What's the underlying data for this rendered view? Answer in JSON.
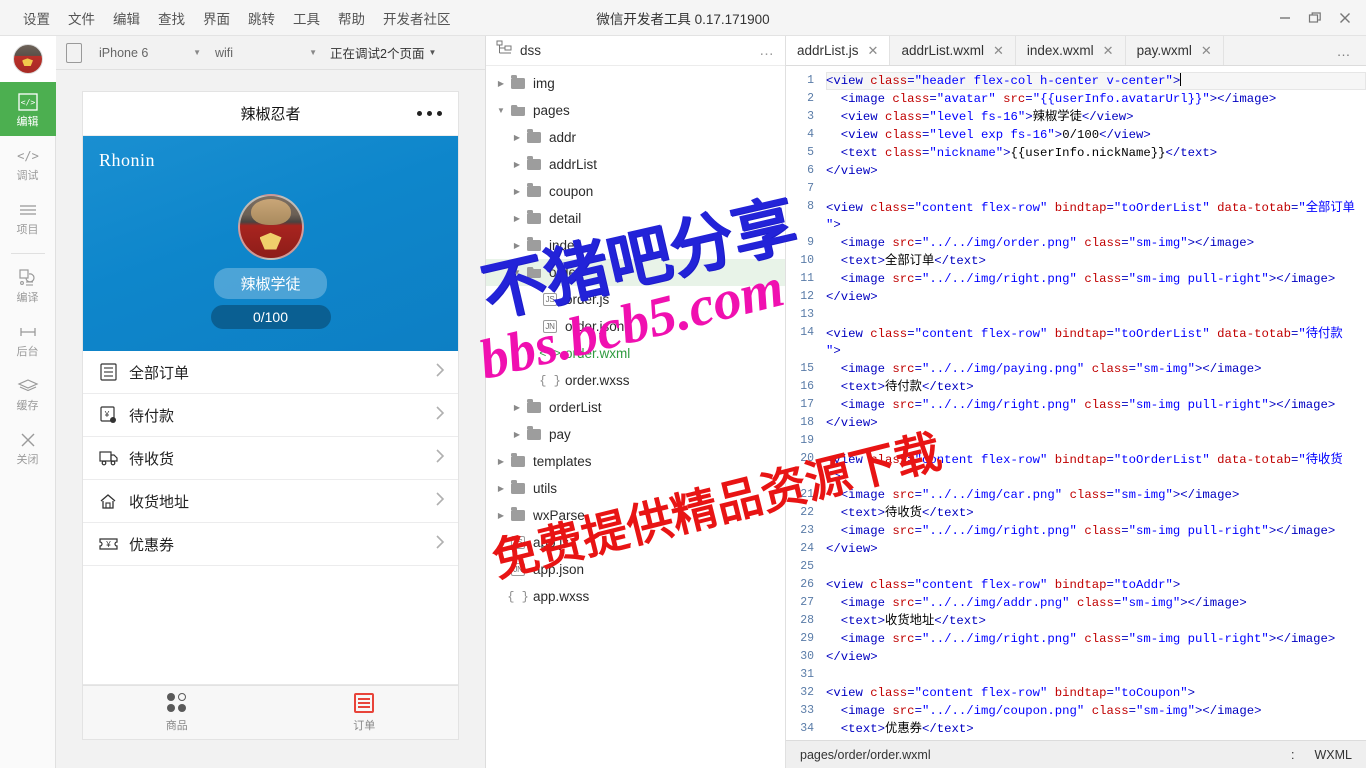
{
  "window": {
    "title": "微信开发者工具 0.17.171900",
    "menu": [
      "设置",
      "文件",
      "编辑",
      "查找",
      "界面",
      "跳转",
      "工具",
      "帮助",
      "开发者社区"
    ],
    "controls": [
      "minimize-button",
      "restore-button",
      "close-button"
    ]
  },
  "rail": {
    "avatar": "user-avatar",
    "items": [
      {
        "label": "编辑",
        "icon": "code-box-icon",
        "active": true
      },
      {
        "label": "调试",
        "icon": "code-icon",
        "active": false
      },
      {
        "label": "项目",
        "icon": "lines-icon",
        "active": false
      },
      {
        "label": "编译",
        "icon": "compile-icon",
        "active": false
      },
      {
        "label": "后台",
        "icon": "background-icon",
        "active": false
      },
      {
        "label": "缓存",
        "icon": "layers-icon",
        "active": false
      },
      {
        "label": "关闭",
        "icon": "close-icon",
        "active": false
      }
    ]
  },
  "simulator": {
    "toolbar": {
      "rotate": "rotate-device-button",
      "device": "iPhone 6",
      "network": "wifi",
      "debug_status": "正在调试2个页面"
    },
    "phone": {
      "nav_title": "辣椒忍者",
      "menu_dots": "more-dots-icon",
      "nickname": "Rhonin",
      "level_badge": "辣椒学徒",
      "exp": "0/100",
      "rows": [
        {
          "label": "全部订单",
          "icon": "order-list-icon"
        },
        {
          "label": "待付款",
          "icon": "pay-pending-icon"
        },
        {
          "label": "待收货",
          "icon": "delivery-truck-icon"
        },
        {
          "label": "收货地址",
          "icon": "home-address-icon"
        },
        {
          "label": "优惠券",
          "icon": "coupon-icon"
        }
      ],
      "tabs": [
        {
          "label": "商品",
          "icon": "grid-dots-icon",
          "active": false
        },
        {
          "label": "订单",
          "icon": "order-list-icon",
          "active": true
        }
      ]
    }
  },
  "tree": {
    "project_name": "dss",
    "more": "…",
    "nodes": [
      {
        "label": "img",
        "type": "folder",
        "depth": 0,
        "open": false,
        "sel": false
      },
      {
        "label": "pages",
        "type": "folder",
        "depth": 0,
        "open": true,
        "sel": false
      },
      {
        "label": "addr",
        "type": "folder",
        "depth": 1,
        "open": false,
        "sel": false
      },
      {
        "label": "addrList",
        "type": "folder",
        "depth": 1,
        "open": false,
        "sel": false
      },
      {
        "label": "coupon",
        "type": "folder",
        "depth": 1,
        "open": false,
        "sel": false
      },
      {
        "label": "detail",
        "type": "folder",
        "depth": 1,
        "open": false,
        "sel": false
      },
      {
        "label": "index",
        "type": "folder",
        "depth": 1,
        "open": false,
        "sel": false
      },
      {
        "label": "order",
        "type": "folder",
        "depth": 1,
        "open": true,
        "sel": true
      },
      {
        "label": "order.js",
        "type": "js",
        "depth": 2,
        "sel": false
      },
      {
        "label": "order.json",
        "type": "json",
        "depth": 2,
        "sel": false
      },
      {
        "label": "order.wxml",
        "type": "wxml",
        "depth": 2,
        "sel": false,
        "green": true
      },
      {
        "label": "order.wxss",
        "type": "wxss",
        "depth": 2,
        "sel": false
      },
      {
        "label": "orderList",
        "type": "folder",
        "depth": 1,
        "open": false,
        "sel": false
      },
      {
        "label": "pay",
        "type": "folder",
        "depth": 1,
        "open": false,
        "sel": false
      },
      {
        "label": "templates",
        "type": "folder",
        "depth": 0,
        "open": false,
        "sel": false
      },
      {
        "label": "utils",
        "type": "folder",
        "depth": 0,
        "open": false,
        "sel": false
      },
      {
        "label": "wxParse",
        "type": "folder",
        "depth": 0,
        "open": false,
        "sel": false
      },
      {
        "label": "app.js",
        "type": "js",
        "depth": 0,
        "sel": false
      },
      {
        "label": "app.json",
        "type": "json",
        "depth": 0,
        "sel": false
      },
      {
        "label": "app.wxss",
        "type": "wxss",
        "depth": 0,
        "sel": false
      }
    ]
  },
  "editor": {
    "tabs": [
      {
        "label": "addrList.js",
        "active": true
      },
      {
        "label": "addrList.wxml",
        "active": false
      },
      {
        "label": "index.wxml",
        "active": false
      },
      {
        "label": "pay.wxml",
        "active": false
      }
    ],
    "tab_more": "…",
    "first_line": 1,
    "last_line": 34,
    "status": {
      "path": "pages/order/order.wxml",
      "sep": ":",
      "language": "WXML"
    }
  },
  "watermarks": {
    "one": "不猪吧分享",
    "two": "bbs.bcb5.com",
    "three": "免费提供精品资源下载"
  }
}
